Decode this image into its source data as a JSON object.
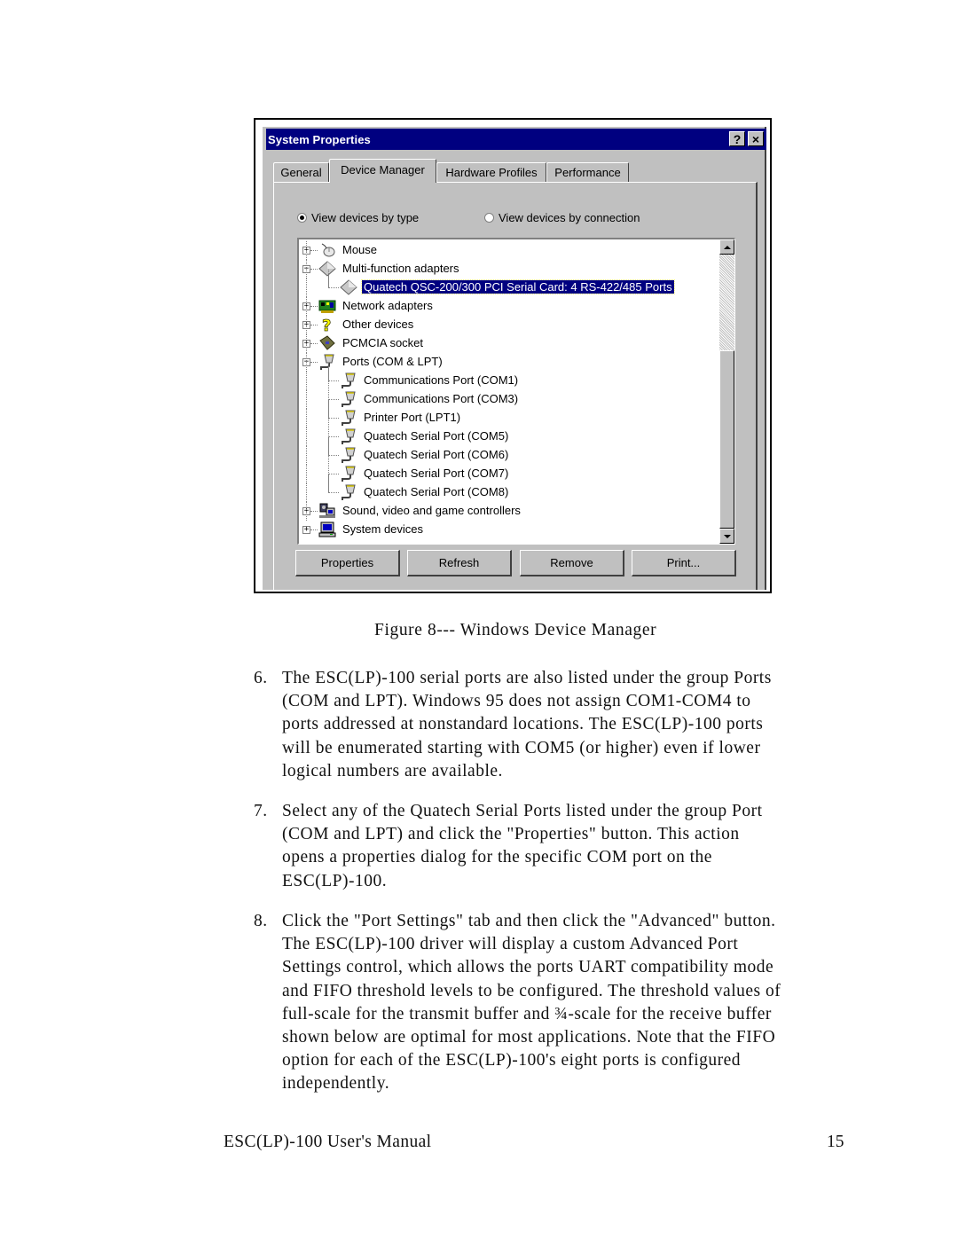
{
  "dialog": {
    "title": "System Properties",
    "help_button": "?",
    "close_button": "×",
    "tabs": [
      {
        "label": "General",
        "active": false
      },
      {
        "label": "Device Manager",
        "active": true
      },
      {
        "label": "Hardware Profiles",
        "active": false
      },
      {
        "label": "Performance",
        "active": false
      }
    ],
    "view_options": {
      "by_type": {
        "label": "View devices by type",
        "selected": true
      },
      "by_connection": {
        "label": "View devices by connection",
        "selected": false
      }
    },
    "tree": [
      {
        "label": "Mouse",
        "level": 0,
        "expander": "+",
        "icon": "mouse-icon"
      },
      {
        "label": "Multi-function adapters",
        "level": 0,
        "expander": "-",
        "icon": "diamond-device-icon"
      },
      {
        "label": "Quatech QSC-200/300 PCI Serial Card: 4 RS-422/485 Ports",
        "level": 1,
        "icon": "diamond-device-icon",
        "selected": true
      },
      {
        "label": "Network adapters",
        "level": 0,
        "expander": "+",
        "icon": "network-card-icon"
      },
      {
        "label": "Other devices",
        "level": 0,
        "expander": "+",
        "icon": "question-mark-icon"
      },
      {
        "label": "PCMCIA socket",
        "level": 0,
        "expander": "+",
        "icon": "pcmcia-icon"
      },
      {
        "label": "Ports (COM & LPT)",
        "level": 0,
        "expander": "-",
        "icon": "port-connector-icon"
      },
      {
        "label": "Communications Port (COM1)",
        "level": 1,
        "icon": "port-connector-icon"
      },
      {
        "label": "Communications Port (COM3)",
        "level": 1,
        "icon": "port-connector-icon"
      },
      {
        "label": "Printer Port (LPT1)",
        "level": 1,
        "icon": "port-connector-icon"
      },
      {
        "label": "Quatech Serial Port (COM5)",
        "level": 1,
        "icon": "port-connector-icon"
      },
      {
        "label": "Quatech Serial Port (COM6)",
        "level": 1,
        "icon": "port-connector-icon"
      },
      {
        "label": "Quatech Serial Port (COM7)",
        "level": 1,
        "icon": "port-connector-icon"
      },
      {
        "label": "Quatech Serial Port (COM8)",
        "level": 1,
        "icon": "port-connector-icon"
      },
      {
        "label": "Sound, video and game controllers",
        "level": 0,
        "expander": "+",
        "icon": "multimedia-icon"
      },
      {
        "label": "System devices",
        "level": 0,
        "expander": "+",
        "icon": "computer-icon"
      }
    ],
    "buttons": {
      "properties": "Properties",
      "refresh": "Refresh",
      "remove": "Remove",
      "print": "Print..."
    }
  },
  "document": {
    "caption": "Figure 8--- Windows  Device Manager",
    "steps": [
      {
        "number": "6.",
        "lines": [
          "The ESC(LP)-100 serial ports are also listed under the group Ports",
          "(COM and LPT). Windows 95 does not assign COM1-COM4 to",
          "ports addressed at nonstandard locations. The ESC(LP)-100 ports",
          "will be enumerated starting with COM5 (or higher) even if lower",
          "logical numbers are available."
        ]
      },
      {
        "number": "7.",
        "lines": [
          "Select any of the Quatech Serial Ports listed under the group Port",
          "(COM and LPT) and click the \"Properties\" button. This action",
          "opens a properties dialog for the specific COM port on the",
          "ESC(LP)-100."
        ]
      },
      {
        "number": "8.",
        "lines": [
          "Click the \"Port Settings\" tab and then click the \"Advanced\" button.",
          "The ESC(LP)-100 driver will display a custom Advanced Port",
          "Settings control, which allows the ports UART compatibility mode",
          "and FIFO threshold levels to be configured. The threshold values of",
          "full-scale for the transmit buffer and ¾-scale for the receive buffer",
          "shown below are optimal for most applications. Note that the FIFO",
          "option for each of the ESC(LP)-100's eight ports is configured",
          "independently."
        ]
      }
    ],
    "footer": {
      "manual_title": "ESC(LP)-100 User's Manual",
      "page_number": "15"
    }
  }
}
